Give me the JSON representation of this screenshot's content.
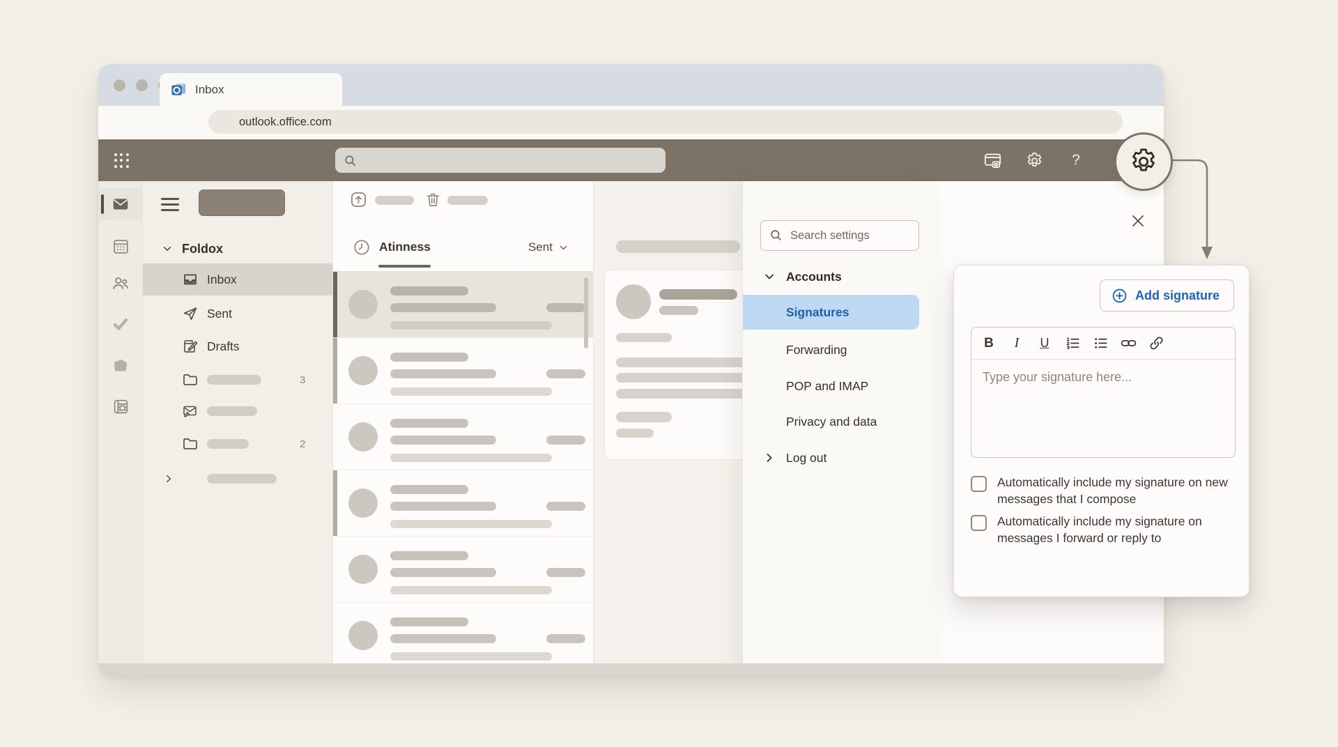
{
  "window": {
    "tab_title": "Inbox",
    "url": "outlook.office.com"
  },
  "appbar": {
    "help_label": "?"
  },
  "folder_pane": {
    "section_label": "Foldox",
    "inbox_label": "Inbox",
    "sent_label": "Sent",
    "drafts_label": "Drafts",
    "folder1_count": "3",
    "folder2_count": "2"
  },
  "message_list": {
    "view_tab": "Atinness",
    "filter": "Sent"
  },
  "settings": {
    "search_placeholder": "Search settings",
    "accounts_label": "Accounts",
    "items": [
      "Signatures",
      "Forwarding",
      "POP and IMAP",
      "Privacy and data"
    ],
    "logout_label": "Log out"
  },
  "signature": {
    "add_button": "Add signature",
    "toolbar": {
      "bold": "B",
      "italic": "I",
      "underline": "U"
    },
    "placeholder": "Type your signature here...",
    "checkbox_new": "Automatically include my signature on new messages that I compose",
    "checkbox_reply": "Automatically include my signature on messages I forward or reply to"
  },
  "colors": {
    "accent_blue": "#1d64b4",
    "selection_blue": "#bfd8f4",
    "header_brown": "#7c7366"
  }
}
